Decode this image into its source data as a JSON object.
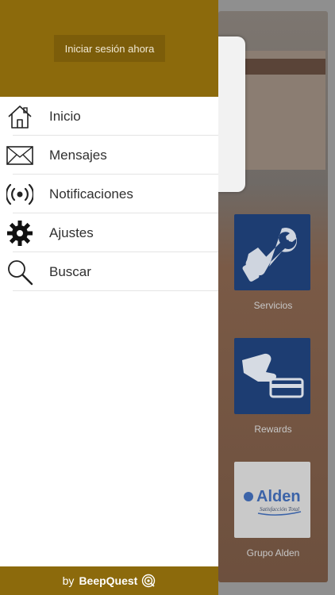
{
  "drawer": {
    "login_label": "Iniciar sesión ahora",
    "menu": [
      {
        "label": "Inicio",
        "icon": "home-icon"
      },
      {
        "label": "Mensajes",
        "icon": "envelope-icon"
      },
      {
        "label": "Notificaciones",
        "icon": "broadcast-icon"
      },
      {
        "label": "Ajustes",
        "icon": "gear-icon"
      },
      {
        "label": "Buscar",
        "icon": "search-icon"
      }
    ],
    "footer": {
      "by": "by",
      "brand": "BeepQuest"
    }
  },
  "background": {
    "tiles": [
      {
        "label": "Servicios",
        "icon": "wrench-hand-icon"
      },
      {
        "label": "Rewards",
        "icon": "card-hand-icon"
      },
      {
        "label": "Grupo Alden",
        "logo_text": "Alden",
        "logo_tagline": "Satisfacción Total"
      }
    ]
  },
  "colors": {
    "brand": "#8c6a0c",
    "tile_blue": "#1d3d72"
  }
}
